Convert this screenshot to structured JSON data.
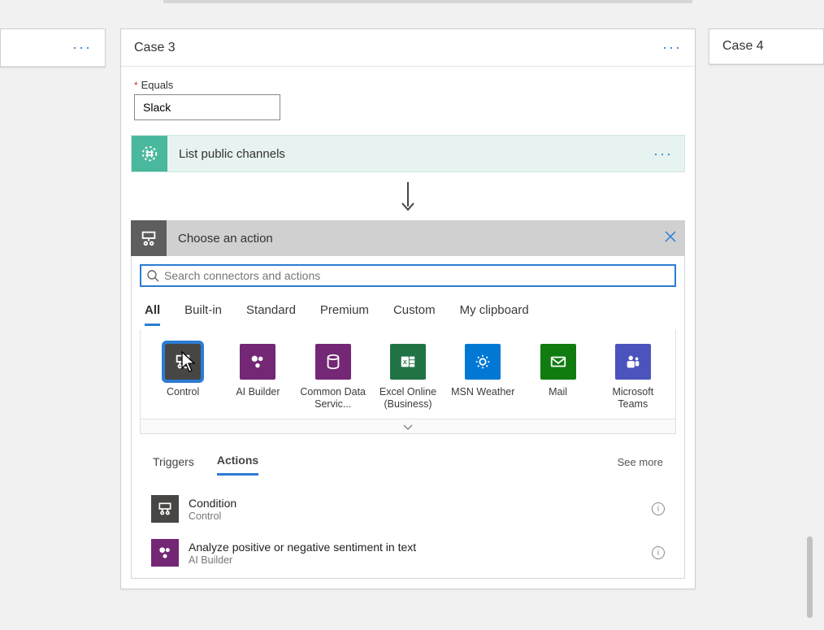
{
  "cases": {
    "left_ellipsis": "···",
    "case3_title": "Case 3",
    "case3_ellipsis": "···",
    "case4_title": "Case 4"
  },
  "equals": {
    "asterisk": "*",
    "label": "Equals",
    "value": "Slack"
  },
  "existing_action": {
    "title": "List public channels",
    "ellipsis": "···"
  },
  "picker": {
    "title": "Choose an action",
    "search_placeholder": "Search connectors and actions",
    "category_tabs": [
      "All",
      "Built-in",
      "Standard",
      "Premium",
      "Custom",
      "My clipboard"
    ],
    "active_category_index": 0,
    "connectors": [
      {
        "label": "Control",
        "color": "#484644",
        "icon": "control"
      },
      {
        "label": "AI Builder",
        "color": "#742774",
        "icon": "aibuilder"
      },
      {
        "label": "Common Data Servic...",
        "color": "#742774",
        "icon": "cds"
      },
      {
        "label": "Excel Online (Business)",
        "color": "#217346",
        "icon": "excel"
      },
      {
        "label": "MSN Weather",
        "color": "#0078d4",
        "icon": "weather"
      },
      {
        "label": "Mail",
        "color": "#107c10",
        "icon": "mail"
      },
      {
        "label": "Microsoft Teams",
        "color": "#4b53bc",
        "icon": "teams"
      }
    ],
    "selected_connector_index": 0,
    "sub_tabs": [
      "Triggers",
      "Actions"
    ],
    "active_sub_tab_index": 1,
    "see_more": "See more",
    "actions": [
      {
        "title": "Condition",
        "subtitle": "Control",
        "icon": "control",
        "color": "#484644"
      },
      {
        "title": "Analyze positive or negative sentiment in text",
        "subtitle": "AI Builder",
        "icon": "aibuilder",
        "color": "#742774"
      }
    ]
  }
}
